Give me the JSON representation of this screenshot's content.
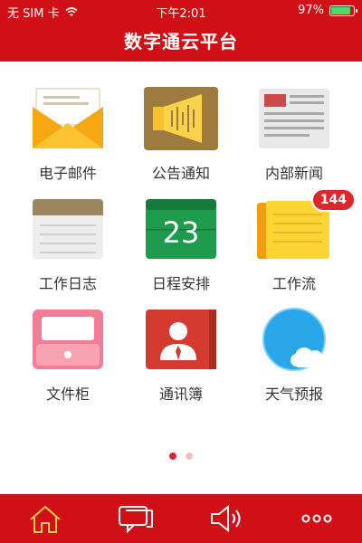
{
  "status_bar": {
    "carrier": "无 SIM 卡",
    "time": "下午2:01",
    "battery_percent": "97%",
    "battery_level": 0.97
  },
  "header": {
    "title": "数字通云平台"
  },
  "apps": [
    {
      "label": "电子邮件"
    },
    {
      "label": "公告通知"
    },
    {
      "label": "内部新闻"
    },
    {
      "label": "工作日志"
    },
    {
      "label": "日程安排",
      "date_number": "23"
    },
    {
      "label": "工作流",
      "badge": "144"
    },
    {
      "label": "文件柜"
    },
    {
      "label": "通讯簿"
    },
    {
      "label": "天气预报"
    }
  ],
  "pagination": {
    "pages": 2,
    "current": 1
  },
  "tab_bar": {
    "items": [
      {
        "icon": "home-icon"
      },
      {
        "icon": "messages-icon"
      },
      {
        "icon": "speaker-icon"
      },
      {
        "icon": "more-icon"
      }
    ]
  },
  "colors": {
    "brand_red": "#d10f16",
    "badge_red": "#e0262c"
  }
}
